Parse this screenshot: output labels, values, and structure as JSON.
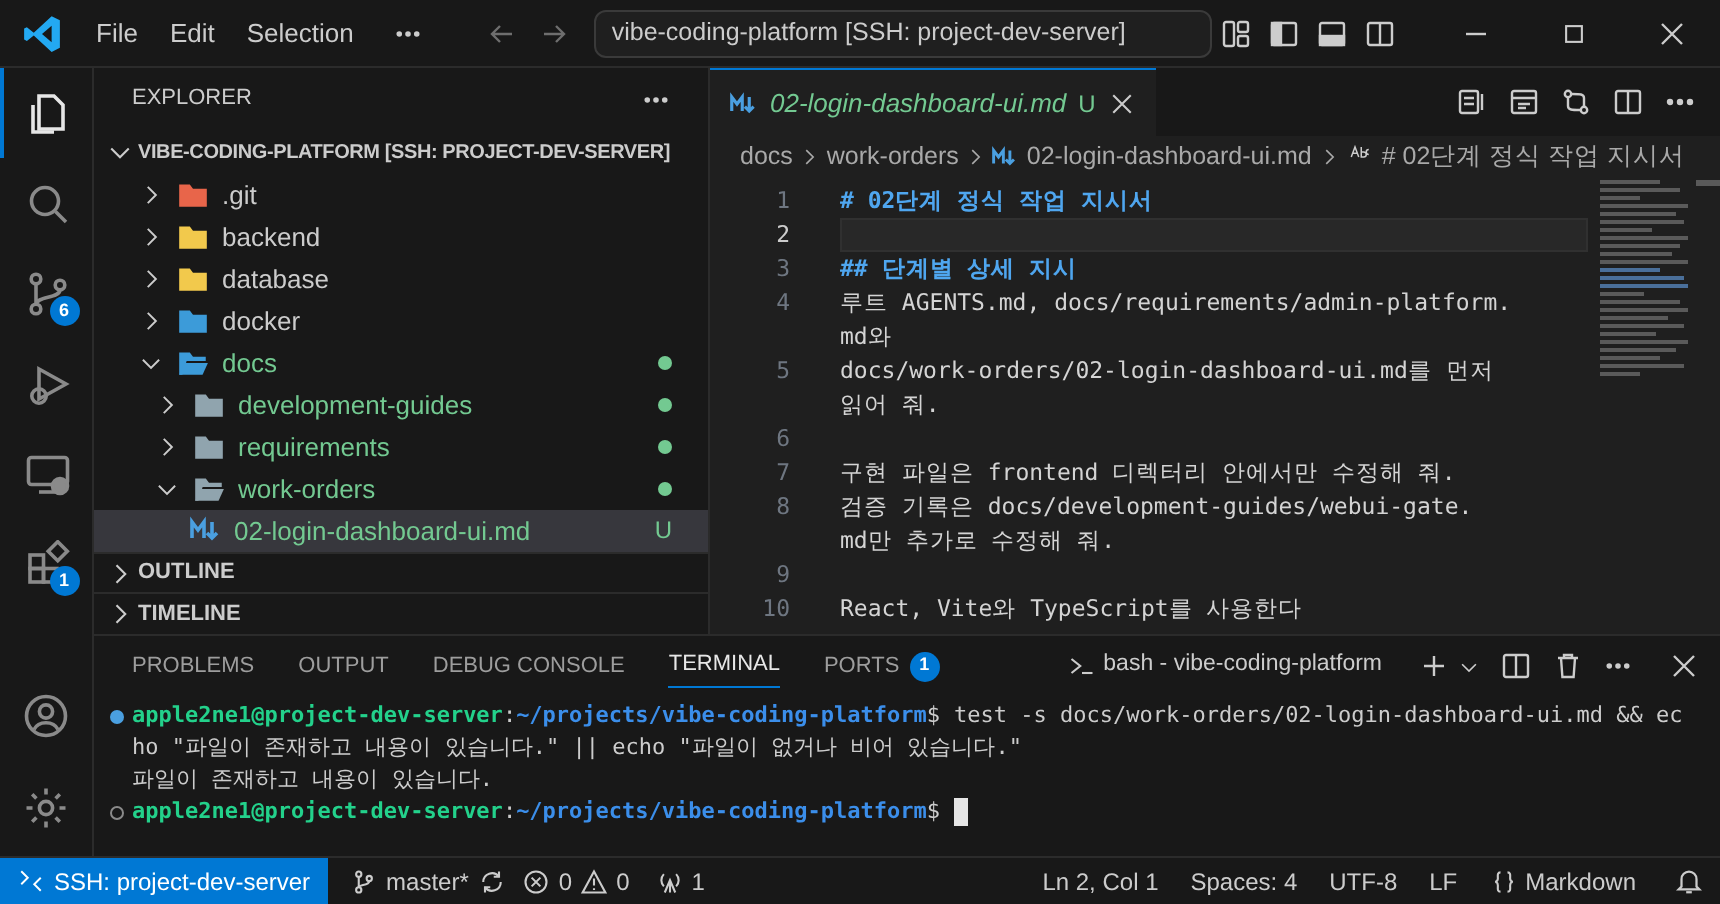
{
  "title_bar": {
    "menus": [
      "File",
      "Edit",
      "Selection"
    ],
    "command_center": "vibe-coding-platform [SSH: project-dev-server]"
  },
  "activity_bar": {
    "items": [
      {
        "kind": "explorer",
        "selected": true
      },
      {
        "kind": "search",
        "selected": false
      },
      {
        "kind": "source-control",
        "selected": false,
        "badge": "6"
      },
      {
        "kind": "run-debug",
        "selected": false
      },
      {
        "kind": "remote",
        "selected": false
      },
      {
        "kind": "extensions",
        "selected": false,
        "badge": "1"
      }
    ]
  },
  "sidebar": {
    "title": "EXPLORER",
    "root": "VIBE-CODING-PLATFORM [SSH: PROJECT-DEV-SERVER]",
    "tree": [
      {
        "label": ".git",
        "kind": "folder",
        "color": "#e8654a",
        "expanded": false,
        "changed": false,
        "selected": false
      },
      {
        "label": "backend",
        "kind": "folder",
        "color": "#f2c94c",
        "expanded": false,
        "changed": false,
        "selected": false
      },
      {
        "label": "database",
        "kind": "folder",
        "color": "#f2c94c",
        "expanded": false,
        "changed": false,
        "selected": false
      },
      {
        "label": "docker",
        "kind": "folder",
        "color": "#3c9bd9",
        "expanded": false,
        "changed": false,
        "selected": false
      },
      {
        "label": "docs",
        "kind": "folder",
        "color": "#3c9bd9",
        "expanded": true,
        "changed": true,
        "selected": false,
        "children": [
          {
            "label": "development-guides",
            "kind": "folder",
            "color": "#90a4ae",
            "expanded": false,
            "changed": true,
            "selected": false
          },
          {
            "label": "requirements",
            "kind": "folder",
            "color": "#90a4ae",
            "expanded": false,
            "changed": true,
            "selected": false
          },
          {
            "label": "work-orders",
            "kind": "folder",
            "color": "#90a4ae",
            "expanded": true,
            "changed": true,
            "selected": false,
            "children": [
              {
                "label": "02-login-dashboard-ui.md",
                "kind": "file",
                "changed": true,
                "badge": "U",
                "selected": true
              }
            ]
          }
        ]
      }
    ],
    "sections": [
      {
        "label": "OUTLINE",
        "expanded": false
      },
      {
        "label": "TIMELINE",
        "expanded": false
      }
    ]
  },
  "editor": {
    "tabs": [
      {
        "label": "02-login-dashboard-ui.md",
        "badge": "U",
        "selected": true
      }
    ],
    "breadcrumbs": [
      "docs",
      "work-orders",
      "02-login-dashboard-ui.md",
      "# 02단계 정식 작업 지시서"
    ],
    "lines": [
      {
        "number": "1",
        "kind": "heading",
        "current": false,
        "text": [
          "# 02단계 정식 작업 지시서"
        ]
      },
      {
        "number": "2",
        "current": true
      },
      {
        "number": "3",
        "kind": "heading",
        "current": false,
        "text": [
          "## 단계별 상세 지시"
        ]
      },
      {
        "number": "4",
        "kind": "text",
        "current": false,
        "text": [
          "루트 AGENTS.md, docs/requirements/admin-platform.",
          "md와"
        ]
      },
      {
        "number": "5",
        "kind": "text",
        "current": false,
        "text": [
          "docs/work-orders/02-login-dashboard-ui.md를 먼저",
          "읽어 줘."
        ]
      },
      {
        "number": "6",
        "current": false
      },
      {
        "number": "7",
        "kind": "text",
        "current": false,
        "text": [
          "구현 파일은 frontend 디렉터리 안에서만 수정해 줘."
        ]
      },
      {
        "number": "8",
        "kind": "text",
        "current": false,
        "text": [
          "검증 기록은 docs/development-guides/webui-gate.",
          "md만 추가로 수정해 줘."
        ]
      },
      {
        "number": "9",
        "current": false
      },
      {
        "number": "10",
        "kind": "text",
        "current": false,
        "text": [
          "React, Vite와 TypeScript를 사용한다"
        ]
      }
    ]
  },
  "panel": {
    "tabs": [
      {
        "label": "PROBLEMS",
        "selected": false
      },
      {
        "label": "OUTPUT",
        "selected": false
      },
      {
        "label": "DEBUG CONSOLE",
        "selected": false
      },
      {
        "label": "TERMINAL",
        "selected": true
      },
      {
        "label": "PORTS",
        "selected": false,
        "badge": "1"
      }
    ],
    "terminal_name": "bash - vibe-coding-platform",
    "terminal_lines": [
      {
        "kind": "prompt",
        "succeeded": true,
        "user": "apple2ne1@project-dev-server",
        "separator": ":",
        "path": "~/projects/vibe-coding-platform",
        "prompt_sign": "$",
        "command": [
          "test -s docs/work-orders/02-login-dashboard-ui.md && ec",
          "ho \"파일이 존재하고 내용이 있습니다.\" || echo \"파일이 없거나 비어 있습니다.\""
        ]
      },
      {
        "kind": "output",
        "text": "파일이 존재하고 내용이 있습니다."
      },
      {
        "kind": "prompt",
        "succeeded": false,
        "user": "apple2ne1@project-dev-server",
        "separator": ":",
        "path": "~/projects/vibe-coding-platform",
        "prompt_sign": "$",
        "cursor": true
      }
    ]
  },
  "status_bar": {
    "remote": "SSH: project-dev-server",
    "branch": "master*",
    "errors": "0",
    "warnings": "0",
    "ports": "1",
    "position": "Ln 2, Col 1",
    "indent": "Spaces: 4",
    "encoding": "UTF-8",
    "eol": "LF",
    "language": "Markdown"
  }
}
